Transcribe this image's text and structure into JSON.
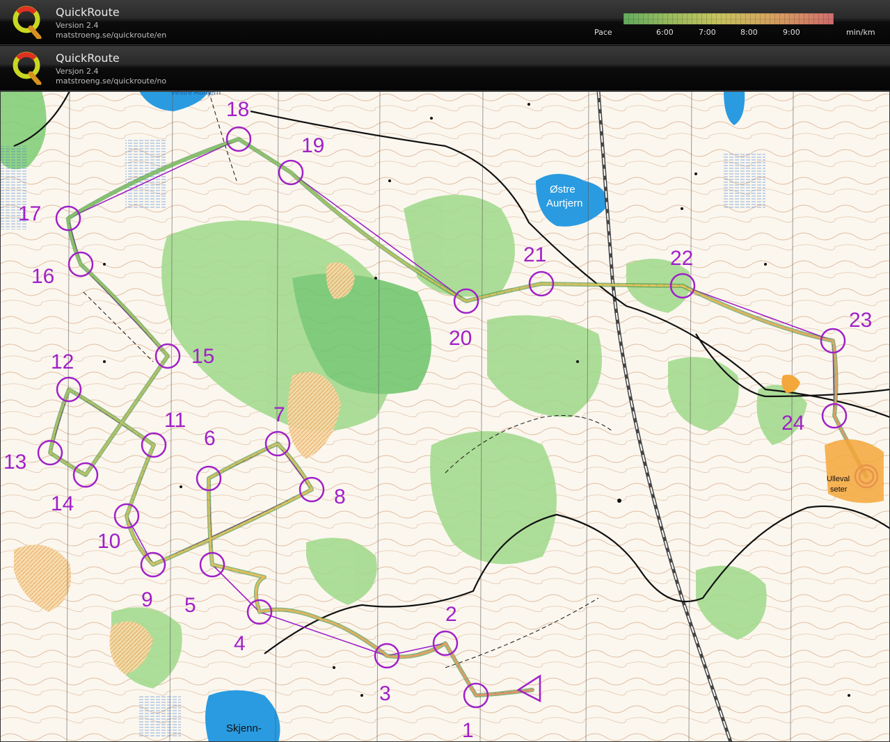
{
  "headers": [
    {
      "title": "QuickRoute",
      "version": "Version 2.4",
      "url": "matstroeng.se/quickroute/en"
    },
    {
      "title": "QuickRoute",
      "version": "Versjon 2.4",
      "url": "matstroeng.se/quickroute/no"
    }
  ],
  "pace_legend": {
    "label": "Pace",
    "ticks": [
      "6:00",
      "7:00",
      "8:00",
      "9:00"
    ],
    "unit": "min/km",
    "colors": [
      "#6fc36a",
      "#e4e06a",
      "#f07a7a"
    ]
  },
  "map_labels": {
    "lake_top": "Vestre Aurtjern",
    "lake_east_1": "Østre",
    "lake_east_2": "Aurtjern",
    "lake_south": "Skjenn-",
    "finish_1": "Ulleval",
    "finish_2": "seter"
  },
  "controls": [
    {
      "n": "1"
    },
    {
      "n": "2"
    },
    {
      "n": "3"
    },
    {
      "n": "4"
    },
    {
      "n": "5"
    },
    {
      "n": "6"
    },
    {
      "n": "7"
    },
    {
      "n": "8"
    },
    {
      "n": "9"
    },
    {
      "n": "10"
    },
    {
      "n": "11"
    },
    {
      "n": "12"
    },
    {
      "n": "13"
    },
    {
      "n": "14"
    },
    {
      "n": "15"
    },
    {
      "n": "16"
    },
    {
      "n": "17"
    },
    {
      "n": "18"
    },
    {
      "n": "19"
    },
    {
      "n": "20"
    },
    {
      "n": "21"
    },
    {
      "n": "22"
    },
    {
      "n": "23"
    },
    {
      "n": "24"
    }
  ],
  "colors": {
    "course": "#a020c8",
    "route_fast": "#6fc36a",
    "route_slow": "#e07070"
  }
}
